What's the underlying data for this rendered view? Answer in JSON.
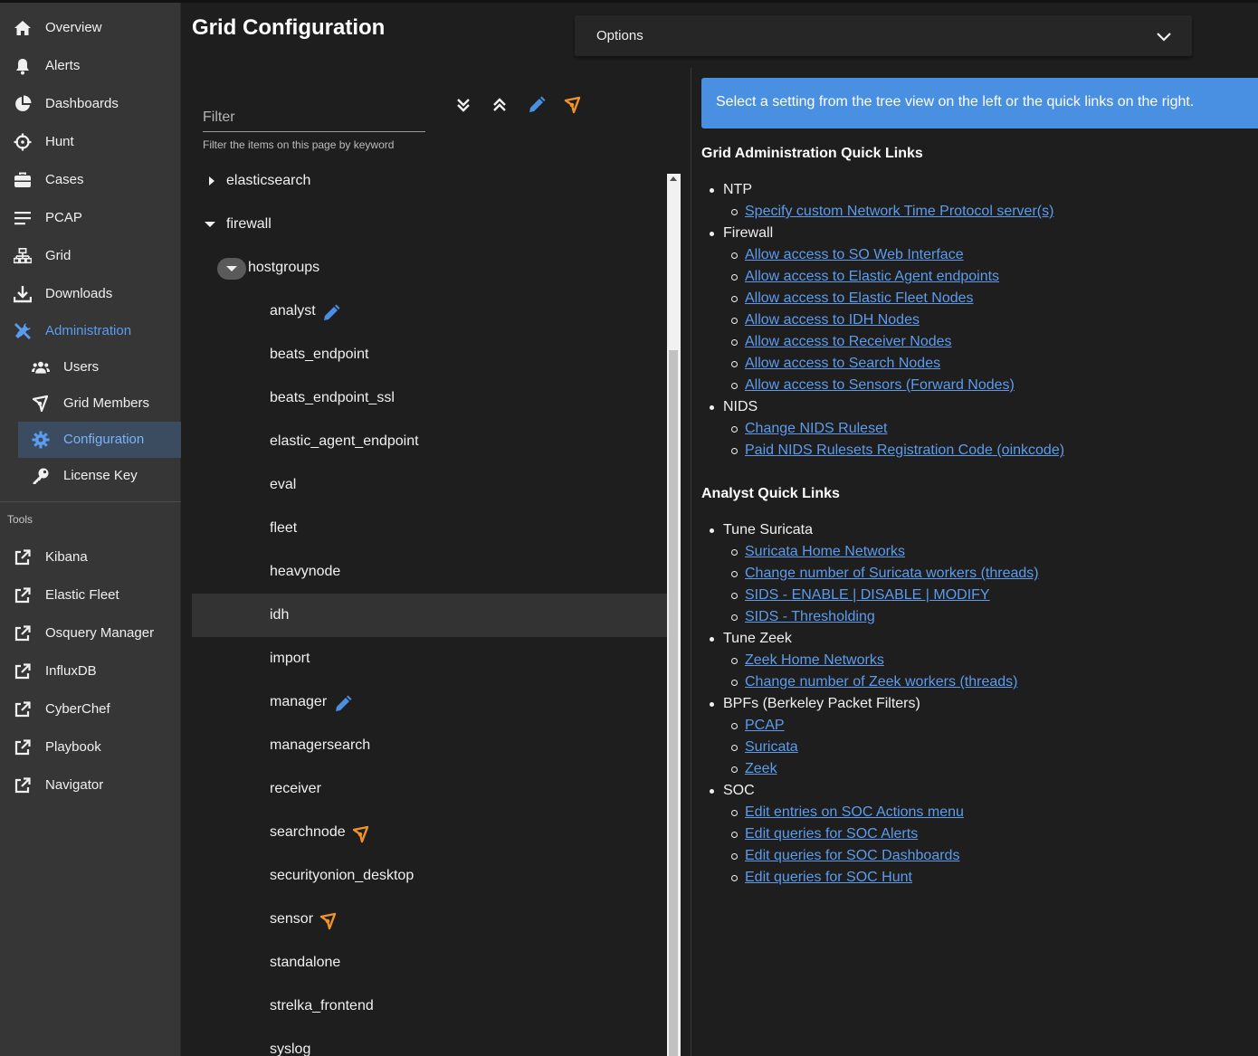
{
  "sidebar": {
    "nav": [
      {
        "label": "Overview",
        "icon": "home-icon"
      },
      {
        "label": "Alerts",
        "icon": "bell-icon"
      },
      {
        "label": "Dashboards",
        "icon": "pie-chart-icon"
      },
      {
        "label": "Hunt",
        "icon": "crosshairs-icon"
      },
      {
        "label": "Cases",
        "icon": "briefcase-icon"
      },
      {
        "label": "PCAP",
        "icon": "list-icon"
      },
      {
        "label": "Grid",
        "icon": "network-icon"
      },
      {
        "label": "Downloads",
        "icon": "download-icon"
      },
      {
        "label": "Administration",
        "icon": "tools-icon"
      }
    ],
    "admin_sub": [
      {
        "label": "Users",
        "icon": "users-icon"
      },
      {
        "label": "Grid Members",
        "icon": "grid-members-icon"
      },
      {
        "label": "Configuration",
        "icon": "gear-icon"
      },
      {
        "label": "License Key",
        "icon": "key-icon"
      }
    ],
    "tools_heading": "Tools",
    "tools": [
      {
        "label": "Kibana",
        "icon": "external-link-icon"
      },
      {
        "label": "Elastic Fleet",
        "icon": "external-link-icon"
      },
      {
        "label": "Osquery Manager",
        "icon": "external-link-icon"
      },
      {
        "label": "InfluxDB",
        "icon": "external-link-icon"
      },
      {
        "label": "CyberChef",
        "icon": "external-link-icon"
      },
      {
        "label": "Playbook",
        "icon": "external-link-icon"
      },
      {
        "label": "Navigator",
        "icon": "external-link-icon"
      }
    ],
    "accent_color": "#5b9cf0"
  },
  "header": {
    "title": "Grid Configuration",
    "options_label": "Options"
  },
  "filter": {
    "placeholder": "Filter",
    "hint": "Filter the items on this page by keyword"
  },
  "toolbar": {
    "icons": [
      "expand-all-icon",
      "collapse-all-icon",
      "pencil-icon",
      "grid-members-icon"
    ],
    "edit_color": "#4a90e2",
    "node_color": "#f0922b"
  },
  "tree": {
    "top_items": [
      {
        "label": "elasticsearch",
        "expanded": false
      },
      {
        "label": "firewall",
        "expanded": true
      }
    ],
    "group": {
      "label": "hostgroups",
      "expanded": true
    },
    "children": [
      {
        "label": "analyst",
        "badge": "pencil-icon"
      },
      {
        "label": "beats_endpoint",
        "badge": ""
      },
      {
        "label": "beats_endpoint_ssl",
        "badge": ""
      },
      {
        "label": "elastic_agent_endpoint",
        "badge": ""
      },
      {
        "label": "eval",
        "badge": ""
      },
      {
        "label": "fleet",
        "badge": ""
      },
      {
        "label": "heavynode",
        "badge": ""
      },
      {
        "label": "idh",
        "badge": "",
        "selected": true
      },
      {
        "label": "import",
        "badge": ""
      },
      {
        "label": "manager",
        "badge": "pencil-icon"
      },
      {
        "label": "managersearch",
        "badge": ""
      },
      {
        "label": "receiver",
        "badge": ""
      },
      {
        "label": "searchnode",
        "badge": "grid-members-icon"
      },
      {
        "label": "securityonion_desktop",
        "badge": ""
      },
      {
        "label": "sensor",
        "badge": "grid-members-icon"
      },
      {
        "label": "standalone",
        "badge": ""
      },
      {
        "label": "strelka_frontend",
        "badge": ""
      },
      {
        "label": "syslog",
        "badge": ""
      }
    ]
  },
  "info_banner": "Select a setting from the tree view on the left or the quick links on the right.",
  "grid_admin": {
    "heading": "Grid Administration Quick Links",
    "categories": [
      {
        "label": "NTP",
        "links": [
          "Specify custom Network Time Protocol server(s)"
        ]
      },
      {
        "label": "Firewall",
        "links": [
          "Allow access to SO Web Interface",
          "Allow access to Elastic Agent endpoints",
          "Allow access to Elastic Fleet Nodes",
          "Allow access to IDH Nodes",
          "Allow access to Receiver Nodes",
          "Allow access to Search Nodes",
          "Allow access to Sensors (Forward Nodes)"
        ]
      },
      {
        "label": "NIDS",
        "links": [
          "Change NIDS Ruleset",
          "Paid NIDS Rulesets Registration Code (oinkcode)"
        ]
      }
    ]
  },
  "analyst": {
    "heading": "Analyst Quick Links",
    "categories": [
      {
        "label": "Tune Suricata",
        "links": [
          "Suricata Home Networks",
          "Change number of Suricata workers (threads)",
          "SIDS - ENABLE | DISABLE | MODIFY",
          "SIDS - Thresholding"
        ]
      },
      {
        "label": "Tune Zeek",
        "links": [
          "Zeek Home Networks",
          "Change number of Zeek workers (threads)"
        ]
      },
      {
        "label": "BPFs (Berkeley Packet Filters)",
        "links": [
          "PCAP",
          "Suricata",
          "Zeek"
        ]
      },
      {
        "label": "SOC",
        "links": [
          "Edit entries on SOC Actions menu",
          "Edit queries for SOC Alerts",
          "Edit queries for SOC Dashboards",
          "Edit queries for SOC Hunt"
        ]
      }
    ]
  }
}
